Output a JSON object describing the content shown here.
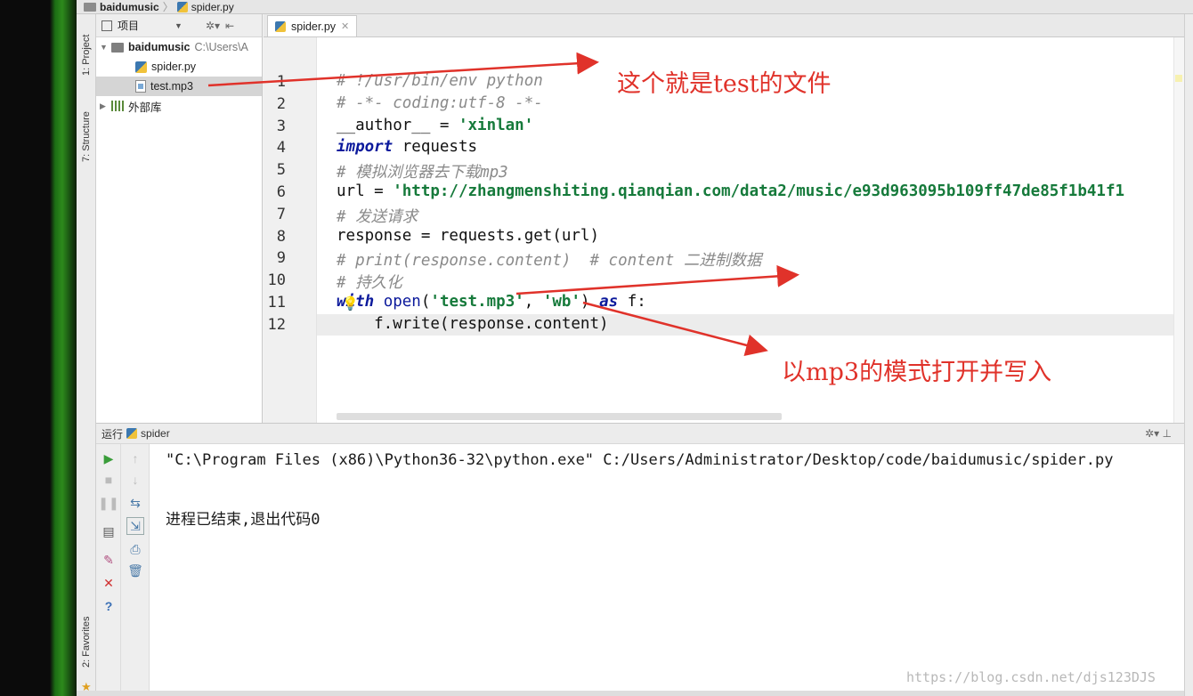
{
  "breadcrumb": {
    "project": "baidumusic",
    "file": "spider.py"
  },
  "left_strip": {
    "project_tab": "1: Project",
    "structure_tab": "7: Structure",
    "favorites_tab": "2: Favorites"
  },
  "project_panel": {
    "header_label": "项目",
    "root": {
      "name": "baidumusic",
      "path": "C:\\Users\\A"
    },
    "files": [
      "spider.py",
      "test.mp3"
    ],
    "external": "外部库"
  },
  "editor": {
    "tab_label": "spider.py",
    "lines": [
      {
        "n": "1",
        "code": "# !/usr/bin/env python"
      },
      {
        "n": "2",
        "code": "# -*- coding:utf-8 -*-"
      },
      {
        "n": "3",
        "code": "__author__ = 'xinlan'"
      },
      {
        "n": "4",
        "code": "import requests"
      },
      {
        "n": "5",
        "code": "# 模拟浏览器去下载mp3"
      },
      {
        "n": "6",
        "code": "url = 'http://zhangmenshiting.qianqian.com/data2/music/e93d963095b109ff47de85f1b41f1"
      },
      {
        "n": "7",
        "code": "# 发送请求"
      },
      {
        "n": "8",
        "code": "response = requests.get(url)"
      },
      {
        "n": "9",
        "code": "# print(response.content)  # content 二进制数据"
      },
      {
        "n": "10",
        "code": "# 持久化"
      },
      {
        "n": "11",
        "code": "with open('test.mp3', 'wb') as f:"
      },
      {
        "n": "12",
        "code": "    f.write(response.content)"
      }
    ]
  },
  "run_panel": {
    "title_prefix": "运行",
    "config": "spider",
    "command": "\"C:\\Program Files (x86)\\Python36-32\\python.exe\" C:/Users/Administrator/Desktop/code/baidumusic/spider.py",
    "exit_message": "进程已结束,退出代码0"
  },
  "annotations": {
    "test_file_note": "这个就是test的文件",
    "mp3_mode_note": "以mp3的模式打开并写入"
  },
  "watermark": "https://blog.csdn.net/djs123DJS",
  "colors": {
    "annotation": "#e0322a",
    "keyword": "#0c1a9c",
    "string": "#167a3b",
    "comment": "#8a8a8a"
  }
}
